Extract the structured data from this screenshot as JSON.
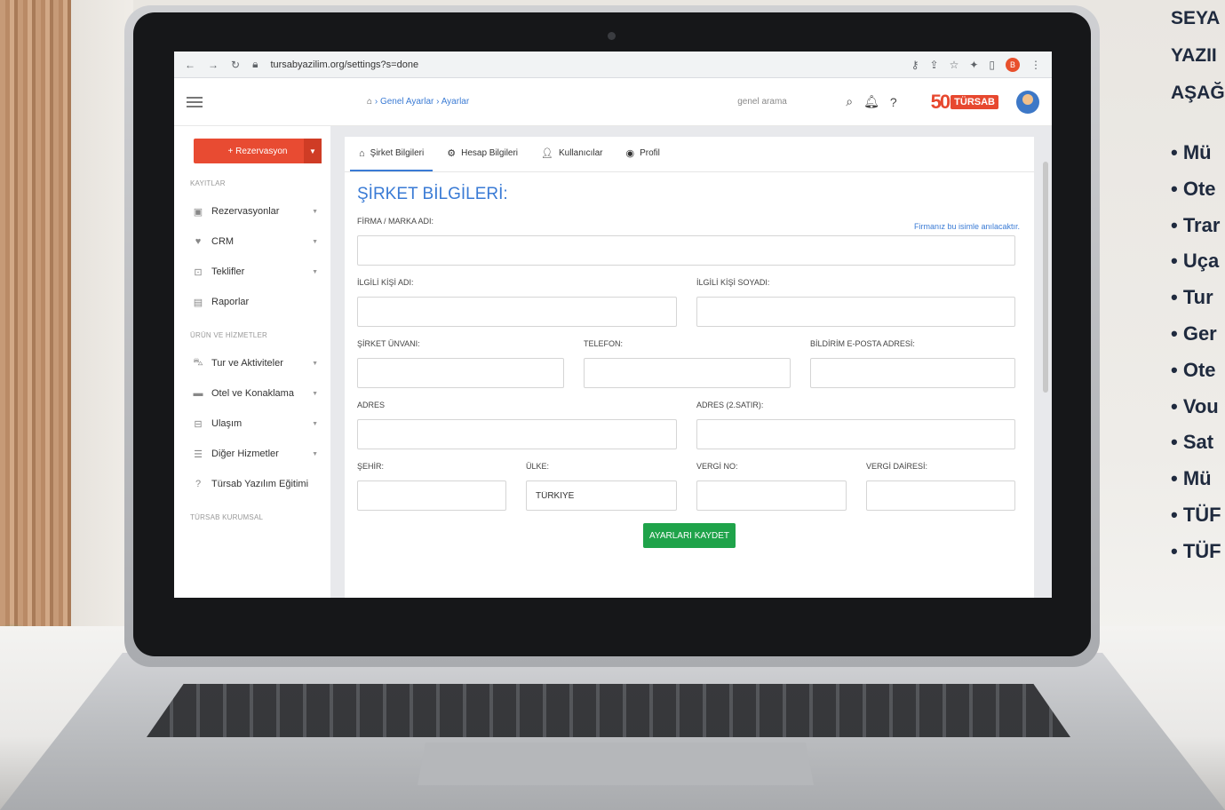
{
  "browser": {
    "url": "tursabyazilim.org/settings?s=done",
    "ext_badge": "B"
  },
  "header": {
    "breadcrumb": [
      "Genel Ayarlar",
      "Ayarlar"
    ],
    "search_placeholder": "genel arama",
    "logo_number": "50",
    "logo_text": "TÜRSAB"
  },
  "sidebar": {
    "reservation_button": "+ Rezervasyon",
    "section_records": "KAYITLAR",
    "records": [
      {
        "label": "Rezervasyonlar",
        "icon": "calendar-icon"
      },
      {
        "label": "CRM",
        "icon": "heart-icon"
      },
      {
        "label": "Teklifler",
        "icon": "offer-icon"
      },
      {
        "label": "Raporlar",
        "icon": "chart-icon"
      }
    ],
    "section_products": "ÜRÜN VE HİZMETLER",
    "products": [
      {
        "label": "Tur ve Aktiviteler",
        "icon": "bus-icon"
      },
      {
        "label": "Otel ve Konaklama",
        "icon": "bed-icon"
      },
      {
        "label": "Ulaşım",
        "icon": "car-icon"
      },
      {
        "label": "Diğer Hizmetler",
        "icon": "list-icon"
      },
      {
        "label": "Türsab Yazılım Eğitimi",
        "icon": "help-icon"
      }
    ],
    "section_corporate": "TÜRSAB KURUMSAL"
  },
  "tabs": [
    {
      "label": "Şirket Bilgileri",
      "icon": "home-icon",
      "active": true
    },
    {
      "label": "Hesap Bilgileri",
      "icon": "gear-icon",
      "active": false
    },
    {
      "label": "Kullanıcılar",
      "icon": "user-icon",
      "active": false
    },
    {
      "label": "Profil",
      "icon": "profile-icon",
      "active": false
    }
  ],
  "form": {
    "title": "ŞİRKET BİLGİLERİ:",
    "hint": "Firmanız bu isimle anılacaktır.",
    "labels": {
      "company_name": "FİRMA / MARKA ADI:",
      "contact_first": "İLGİLİ KİŞİ ADI:",
      "contact_last": "İLGİLİ KİŞİ SOYADI:",
      "title": "ŞİRKET ÜNVANI:",
      "phone": "TELEFON:",
      "email": "BİLDİRİM E-POSTA ADRESİ:",
      "address": "ADRES",
      "address2": "ADRES (2.SATIR):",
      "city": "ŞEHİR:",
      "country": "ÜLKE:",
      "tax_no": "VERGİ NO:",
      "tax_office": "VERGİ DAİRESİ:"
    },
    "values": {
      "country": "TÜRKİYE"
    },
    "save_label": "AYARLARI KAYDET"
  },
  "side_text": {
    "heading": [
      "SEYA",
      "YAZII",
      "AŞAĞ"
    ],
    "items": [
      "Mü",
      "Ote",
      "Trar",
      "Uça",
      "Tur",
      "Ger",
      "Ote",
      "Vou",
      "Sat",
      "Mü",
      "TÜF",
      "TÜF"
    ]
  }
}
